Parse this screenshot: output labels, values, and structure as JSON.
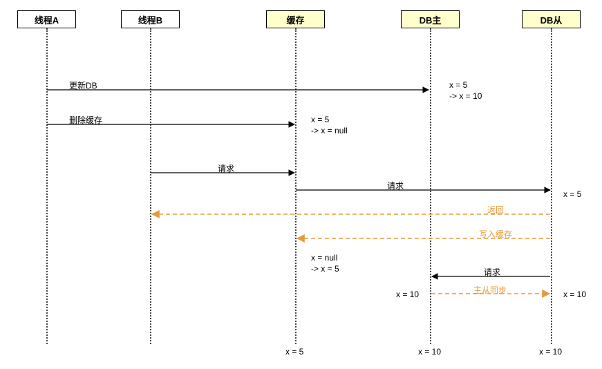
{
  "participants": {
    "threadA": "线程A",
    "threadB": "线程B",
    "cache": "缓存",
    "dbMaster": "DB主",
    "dbSlave": "DB从"
  },
  "messages": {
    "updateDB": "更新DB",
    "deleteCache": "删除缓存",
    "request1": "请求",
    "request2": "请求",
    "returnMsg": "返回",
    "writeCache": "写入缓存",
    "request3": "请求",
    "masterSlaveSync": "主从同步"
  },
  "notes": {
    "dbMasterUpdate1": "x = 5",
    "dbMasterUpdate2": "-> x = 10",
    "cacheDelete1": "x = 5",
    "cacheDelete2": "-> x = null",
    "slaveReadValue": "x = 5",
    "cacheWrite1": "x = null",
    "cacheWrite2": "-> x = 5",
    "masterSyncLeft": "x = 10",
    "slaveSyncRight": "x = 10"
  },
  "endLabels": {
    "cacheEnd": "x = 5",
    "masterEnd": "x = 10",
    "slaveEnd": "x = 10"
  },
  "colors": {
    "solidArrow": "#000000",
    "dashedArrow": "#e49b3b",
    "highlightFill": "#ffffcc"
  }
}
